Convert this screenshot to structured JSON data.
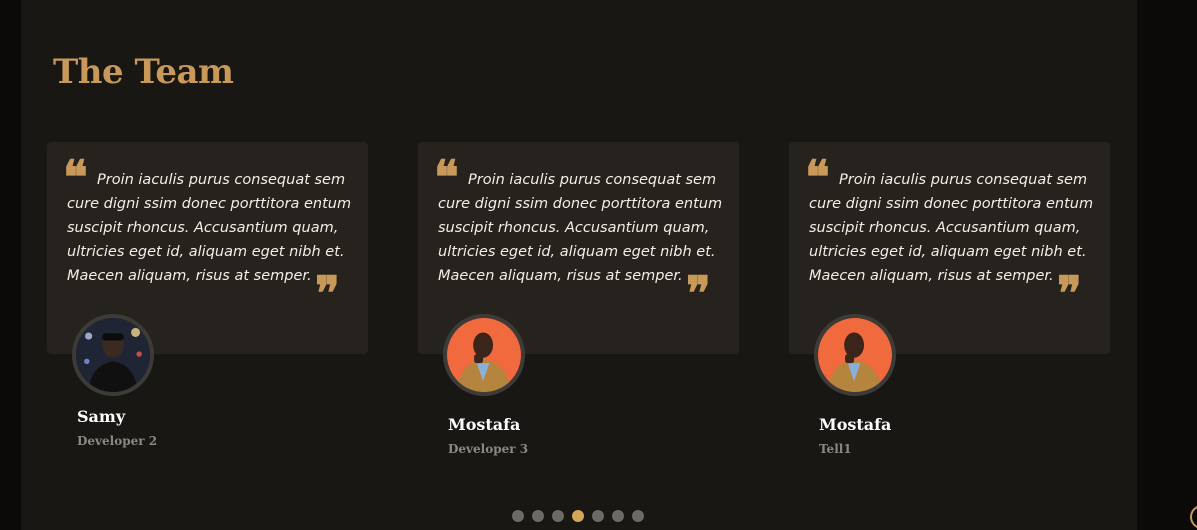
{
  "section": {
    "title": "The Team"
  },
  "testimonials": [
    {
      "text": "Proin iaculis purus consequat sem cure digni ssim donec porttitora entum suscipit rhoncus. Accusantium quam, ultricies eget id, aliquam eget nibh et. Maecen aliquam, risus at semper.",
      "name": "Samy",
      "role": "Developer 2"
    },
    {
      "text": "Proin iaculis purus consequat sem cure digni ssim donec porttitora entum suscipit rhoncus. Accusantium quam, ultricies eget id, aliquam eget nibh et. Maecen aliquam, risus at semper.",
      "name": "Mostafa",
      "role": "Developer 3"
    },
    {
      "text": "Proin iaculis purus consequat sem cure digni ssim donec porttitora entum suscipit rhoncus. Accusantium quam, ultricies eget id, aliquam eget nibh et. Maecen aliquam, risus at semper.",
      "name": "Mostafa",
      "role": "Tell1"
    }
  ],
  "quote_marks": {
    "open": "❝",
    "close": "❞"
  },
  "pagination": {
    "count": 7,
    "active_index": 3
  },
  "colors": {
    "accent": "#c9995a",
    "active_dot": "#d4a65a",
    "inactive_dot": "#6b6a67",
    "card": "#26221d",
    "panel": "#181714"
  }
}
